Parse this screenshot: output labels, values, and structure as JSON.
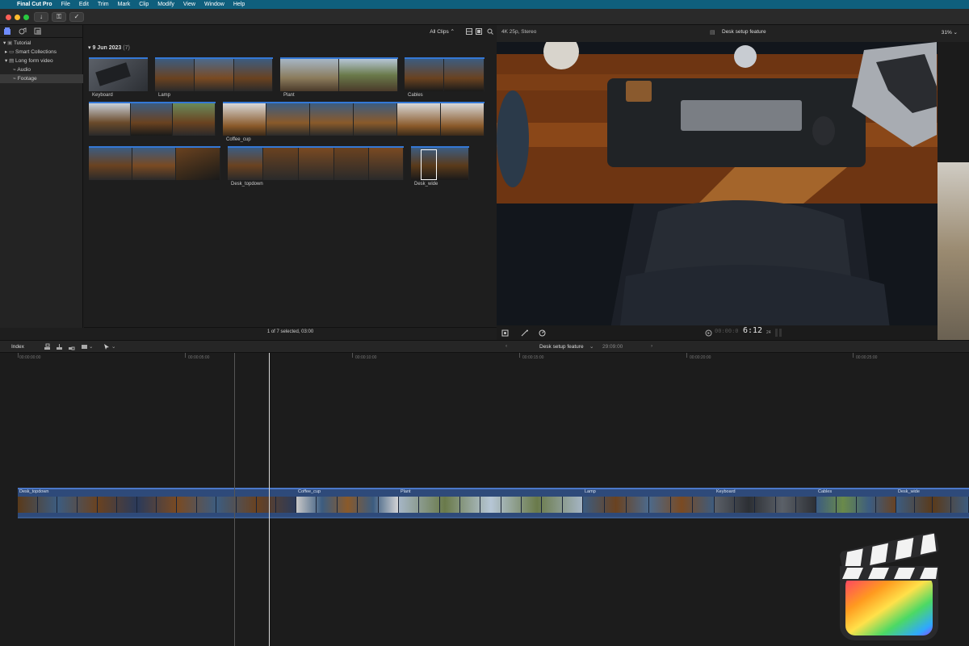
{
  "menubar": {
    "apple": "",
    "app": "Final Cut Pro",
    "items": [
      "File",
      "Edit",
      "Trim",
      "Mark",
      "Clip",
      "Modify",
      "View",
      "Window",
      "Help"
    ]
  },
  "sidebar": {
    "items": [
      {
        "label": "Tutorial",
        "indent": 0
      },
      {
        "label": "Smart Collections",
        "indent": 1
      },
      {
        "label": "Long form video",
        "indent": 1
      },
      {
        "label": "Audio",
        "indent": 2
      },
      {
        "label": "Footage",
        "indent": 2,
        "selected": true
      }
    ]
  },
  "browser": {
    "filter": "All Clips",
    "date_header": "9 Jun 2023",
    "count": "(7)",
    "clips": [
      "Keyboard",
      "Lamp",
      "Plant",
      "Cables",
      "Coffee_cup",
      "Desk_topdown",
      "Desk_wide"
    ],
    "status": "1 of 7 selected, 03:00"
  },
  "viewer": {
    "format": "4K 25p, Stereo",
    "project": "Desk setup feature",
    "zoom": "31%",
    "timecode": "6:12",
    "timecode_suffix": "24"
  },
  "timeline": {
    "index_label": "Index",
    "project": "Desk setup feature",
    "duration": "29:09:00",
    "ruler": [
      "00:00:00:00",
      "00:00:05:00",
      "00:00:10:00",
      "00:00:15:00",
      "00:00:20:00",
      "00:00:25:00"
    ],
    "clips": [
      "Desk_topdown",
      "Coffee_cup",
      "Plant",
      "Lamp",
      "Keyboard",
      "Cables",
      "Desk_wide"
    ]
  },
  "colors": {
    "menubar": "#0f5f7d",
    "accent": "#3478d6",
    "timeline_clip": "#2e4a7a"
  }
}
